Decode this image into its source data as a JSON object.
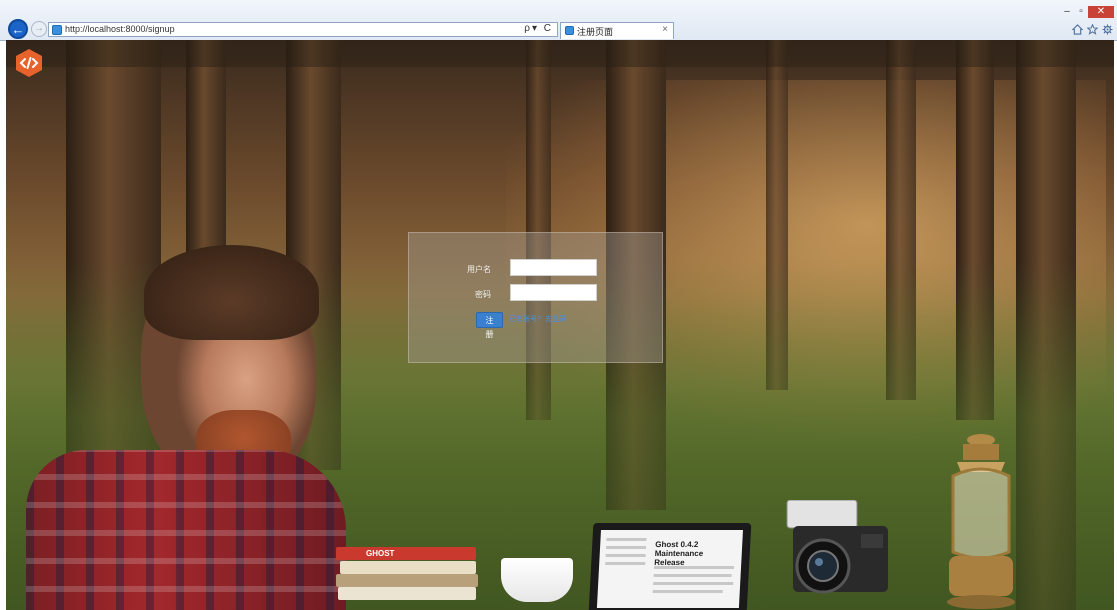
{
  "browser": {
    "url": "http://localhost:8000/signup",
    "tab_title": "注册页面",
    "tab_close": "×",
    "back_icon": "←",
    "forward_icon": "→",
    "address_tools": "ρ▾ C",
    "window_controls": {
      "minimize": "–",
      "maximize": "▫",
      "close": "✕"
    },
    "toolbar_icons": [
      "home-icon",
      "star-icon",
      "gear-icon"
    ]
  },
  "app": {
    "logo_icon": "ghost-logo-icon",
    "accent_color": "#e8632b"
  },
  "signup_form": {
    "username_label": "用户名",
    "password_label": "密码",
    "username_value": "",
    "password_value": "",
    "submit_label": "注册",
    "link_1": "已有账号?",
    "link_2": "去登录",
    "button_color": "#3a7fd0"
  },
  "background": {
    "laptop_text": "Ghost 0.4.2 Maintenance Release",
    "book_text": "GHOST"
  }
}
